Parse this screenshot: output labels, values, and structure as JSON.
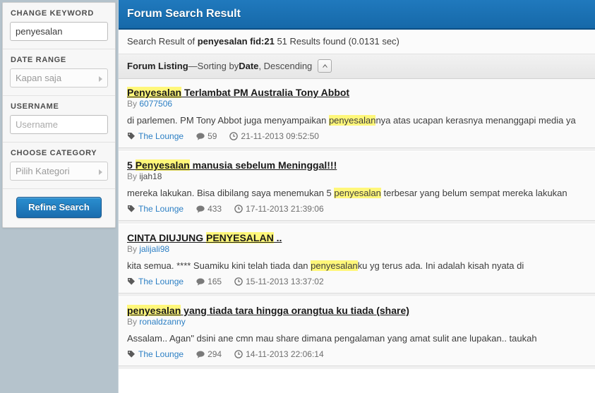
{
  "sidebar": {
    "filters": [
      {
        "label": "CHANGE KEYWORD",
        "type": "text",
        "value": "penyesalan",
        "placeholder": ""
      },
      {
        "label": "DATE RANGE",
        "type": "select",
        "value": "Kapan saja"
      },
      {
        "label": "USERNAME",
        "type": "text",
        "value": "",
        "placeholder": "Username"
      },
      {
        "label": "CHOOSE CATEGORY",
        "type": "select",
        "value": "Pilih Kategori"
      }
    ],
    "refine_button": "Refine Search"
  },
  "main": {
    "header_title": "Forum Search Result",
    "summary": {
      "prefix": "Search Result of ",
      "query": "penyesalan fid:21",
      "suffix": " 51 Results found (0.0131 sec)"
    },
    "sort_bar": {
      "listing_label": "Forum Listing",
      "dash": " — ",
      "sorting_prefix": "Sorting by ",
      "sort_field": "Date",
      "sort_direction": ", Descending",
      "toggle_icon": "chevron-up-icon"
    },
    "results": [
      {
        "title_parts": [
          {
            "text": "Penyesalan",
            "highlight": true
          },
          {
            "text": " Terlambat PM Australia Tony Abbot",
            "highlight": false
          }
        ],
        "by_label": "By ",
        "author": "6077506",
        "author_style": "link",
        "snippet_parts": [
          {
            "text": "di parlemen. PM Tony Abbot juga menyampaikan ",
            "highlight": false
          },
          {
            "text": "penyesalan",
            "highlight": true
          },
          {
            "text": "nya atas ucapan kerasnya menanggapi media ya",
            "highlight": false
          }
        ],
        "forum": "The Lounge",
        "replies": "59",
        "date": "21-11-2013 09:52:50"
      },
      {
        "title_parts": [
          {
            "text": "5 ",
            "highlight": false
          },
          {
            "text": "Penyesalan",
            "highlight": true
          },
          {
            "text": " manusia sebelum Meninggal!!!",
            "highlight": false
          }
        ],
        "by_label": "By ",
        "author": "ijah18",
        "author_style": "dark",
        "snippet_parts": [
          {
            "text": "mereka lakukan. Bisa dibilang saya menemukan 5 ",
            "highlight": false
          },
          {
            "text": "penyesalan",
            "highlight": true
          },
          {
            "text": " terbesar yang belum sempat mereka lakukan",
            "highlight": false
          }
        ],
        "forum": "The Lounge",
        "replies": "433",
        "date": "17-11-2013 21:39:06"
      },
      {
        "title_parts": [
          {
            "text": "CINTA DIUJUNG ",
            "highlight": false
          },
          {
            "text": "PENYESALAN",
            "highlight": true
          },
          {
            "text": " ..",
            "highlight": false
          }
        ],
        "by_label": "By ",
        "author": "jalijali98",
        "author_style": "link",
        "snippet_parts": [
          {
            "text": "kita semua. **** Suamiku kini telah tiada dan ",
            "highlight": false
          },
          {
            "text": "penyesalan",
            "highlight": true
          },
          {
            "text": "ku yg terus ada. Ini adalah kisah nyata di",
            "highlight": false
          }
        ],
        "forum": "The Lounge",
        "replies": "165",
        "date": "15-11-2013 13:37:02"
      },
      {
        "title_parts": [
          {
            "text": "penyesalan",
            "highlight": true
          },
          {
            "text": " yang tiada tara hingga orangtua ku tiada (share)",
            "highlight": false
          }
        ],
        "by_label": "By ",
        "author": "ronaldzanny",
        "author_style": "link",
        "snippet_parts": [
          {
            "text": "Assalam.. Agan\" dsini ane cmn mau share dimana pengalaman yang amat sulit ane lupakan.. taukah",
            "highlight": false
          }
        ],
        "forum": "The Lounge",
        "replies": "294",
        "date": "14-11-2013 22:06:14"
      }
    ]
  },
  "colors": {
    "page_background": "#b5c3cc",
    "header_blue": "#1b70b3",
    "highlight_yellow": "#fff77a",
    "link_blue": "#2c7fc4",
    "button_blue": "#1a6cae"
  }
}
